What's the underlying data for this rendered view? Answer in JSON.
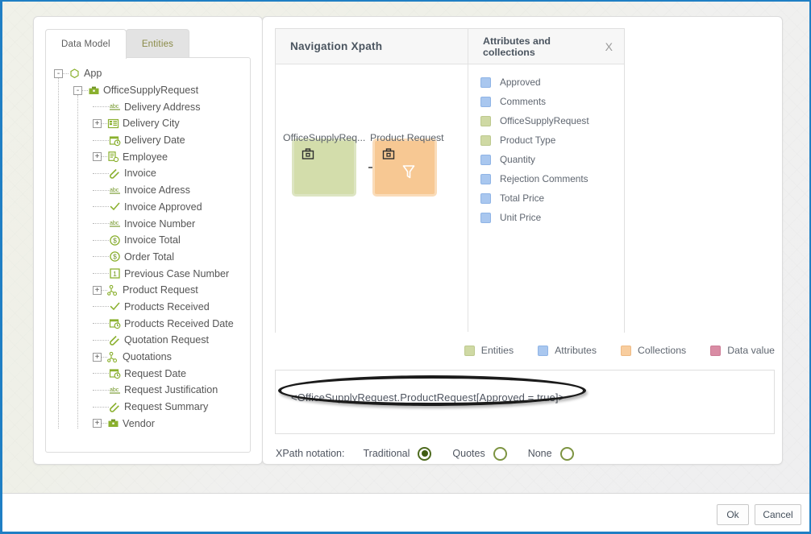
{
  "left_panel": {
    "tabs": [
      {
        "label": "Data Model",
        "active": true
      },
      {
        "label": "Entities",
        "active": false
      }
    ],
    "tree": [
      {
        "label": "App",
        "icon": "hexagon-icon",
        "expander": "-",
        "depth": 0
      },
      {
        "label": "OfficeSupplyRequest",
        "icon": "briefcase-icon",
        "expander": "-",
        "depth": 1
      },
      {
        "label": "Delivery Address",
        "icon": "abc-icon",
        "expander": "",
        "depth": 2
      },
      {
        "label": "Delivery City",
        "icon": "list-icon",
        "expander": "+",
        "depth": 2
      },
      {
        "label": "Delivery Date",
        "icon": "calendar-icon",
        "expander": "",
        "depth": 2
      },
      {
        "label": "Employee",
        "icon": "document-icon",
        "expander": "+",
        "depth": 2
      },
      {
        "label": "Invoice",
        "icon": "paperclip-icon",
        "expander": "",
        "depth": 2
      },
      {
        "label": "Invoice Adress",
        "icon": "abc-icon",
        "expander": "",
        "depth": 2
      },
      {
        "label": "Invoice Approved",
        "icon": "check-icon",
        "expander": "",
        "depth": 2
      },
      {
        "label": "Invoice Number",
        "icon": "abc-icon",
        "expander": "",
        "depth": 2
      },
      {
        "label": "Invoice Total",
        "icon": "currency-icon",
        "expander": "",
        "depth": 2
      },
      {
        "label": "Order Total",
        "icon": "currency-icon",
        "expander": "",
        "depth": 2
      },
      {
        "label": "Previous Case Number",
        "icon": "number-icon",
        "expander": "",
        "depth": 2
      },
      {
        "label": "Product Request",
        "icon": "collection-icon",
        "expander": "+",
        "depth": 2
      },
      {
        "label": "Products Received",
        "icon": "check-icon",
        "expander": "",
        "depth": 2
      },
      {
        "label": "Products Received Date",
        "icon": "calendar-icon",
        "expander": "",
        "depth": 2
      },
      {
        "label": "Quotation Request",
        "icon": "paperclip-icon",
        "expander": "",
        "depth": 2
      },
      {
        "label": "Quotations",
        "icon": "collection-icon",
        "expander": "+",
        "depth": 2
      },
      {
        "label": "Request Date",
        "icon": "calendar-icon",
        "expander": "",
        "depth": 2
      },
      {
        "label": "Request Justification",
        "icon": "abc-icon",
        "expander": "",
        "depth": 2
      },
      {
        "label": "Request Summary",
        "icon": "paperclip-icon",
        "expander": "",
        "depth": 2
      },
      {
        "label": "Vendor",
        "icon": "briefcase-icon",
        "expander": "+",
        "depth": 2
      }
    ]
  },
  "diagram": {
    "title": "Navigation Xpath",
    "nodes": [
      {
        "label": "OfficeSupplyReq...",
        "type": "entity",
        "icon": "briefcase-icon",
        "color": "#d3ddab"
      },
      {
        "label": "Product Request",
        "type": "collection",
        "icon": "briefcase-icon",
        "badge": "filter-icon",
        "color": "#f7c893"
      }
    ]
  },
  "attributes_panel": {
    "title": "Attributes and collections",
    "close_label": "X",
    "items": [
      {
        "label": "Approved",
        "color": "blue"
      },
      {
        "label": "Comments",
        "color": "blue"
      },
      {
        "label": "OfficeSupplyRequest",
        "color": "green"
      },
      {
        "label": "Product Type",
        "color": "green"
      },
      {
        "label": "Quantity",
        "color": "blue"
      },
      {
        "label": "Rejection Comments",
        "color": "blue"
      },
      {
        "label": "Total Price",
        "color": "blue"
      },
      {
        "label": "Unit Price",
        "color": "blue"
      }
    ]
  },
  "legend": [
    {
      "label": "Entities",
      "color": "green"
    },
    {
      "label": "Attributes",
      "color": "blue"
    },
    {
      "label": "Collections",
      "color": "orange"
    },
    {
      "label": "Data value",
      "color": "pink"
    }
  ],
  "xpath": {
    "expression": "<OfficeSupplyRequest.ProductRequest[Approved = true]>"
  },
  "notation": {
    "label": "XPath notation:",
    "options": [
      {
        "label": "Traditional",
        "selected": true
      },
      {
        "label": "Quotes",
        "selected": false
      },
      {
        "label": "None",
        "selected": false
      }
    ]
  },
  "footer": {
    "ok_label": "Ok",
    "cancel_label": "Cancel"
  },
  "colors": {
    "entity": "#d3ddab",
    "collection": "#f7c893",
    "attribute": "#a9c7ef",
    "data_value": "#d98ca4",
    "window_border": "#1f7fc4"
  }
}
